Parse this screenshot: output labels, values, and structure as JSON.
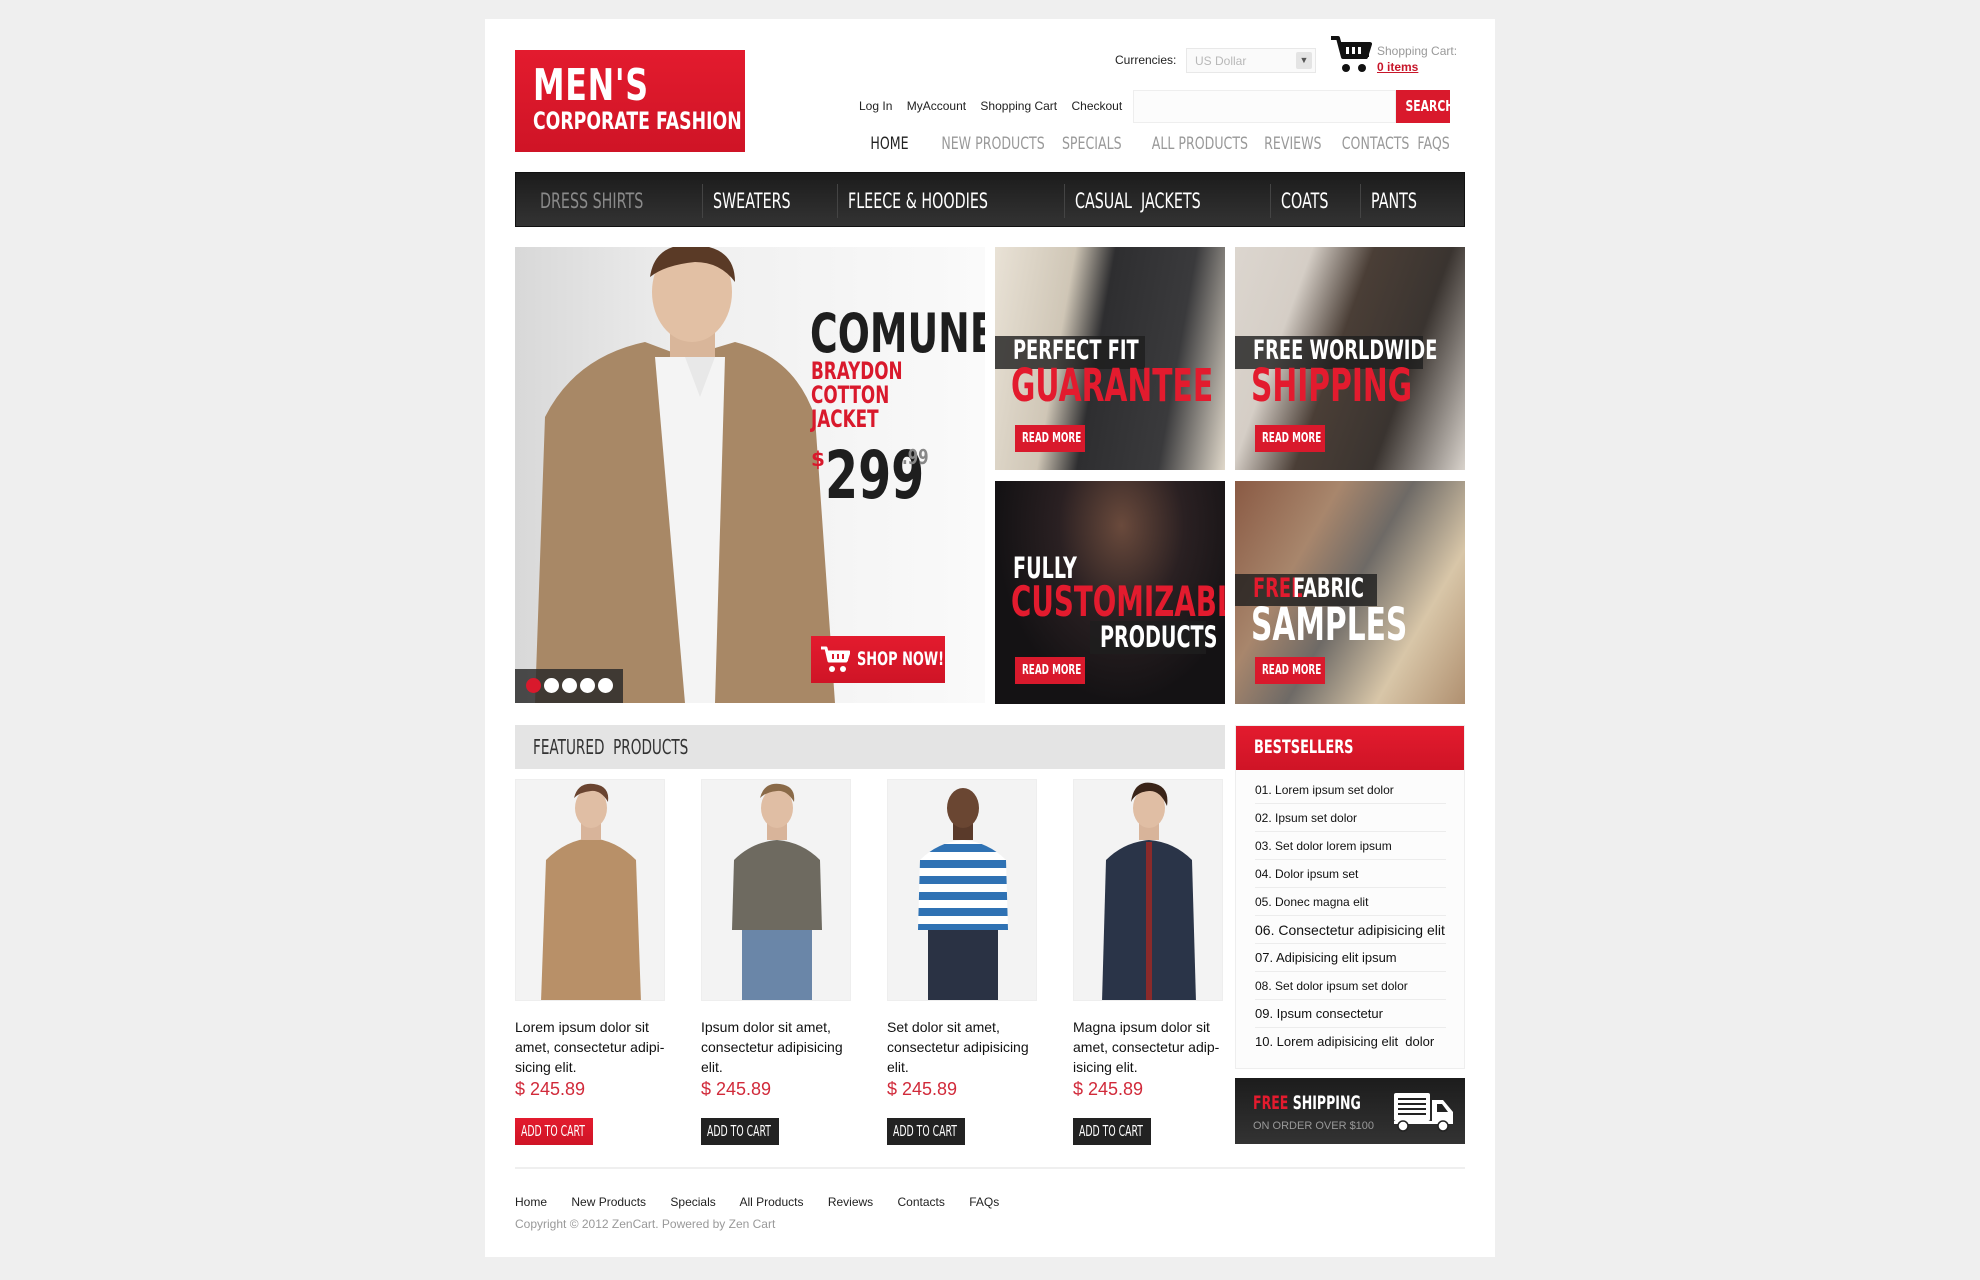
{
  "logo": {
    "line1": "MEN'S",
    "line2": "CORPORATE FASHION"
  },
  "header": {
    "currency_label": "Currencies:",
    "currency_value": "US Dollar",
    "cart_label": "Shopping Cart:",
    "cart_items": "0 items",
    "top_links": [
      "Log In",
      "MyAccount",
      "Shopping Cart",
      "Checkout"
    ],
    "search_placeholder": "",
    "search_button": "SEARCH",
    "main_nav": [
      {
        "label": "HOME",
        "active": true
      },
      {
        "label": "NEW PRODUCTS",
        "active": false
      },
      {
        "label": "SPECIALS",
        "active": false
      },
      {
        "label": "ALL PRODUCTS",
        "active": false
      },
      {
        "label": "REVIEWS",
        "active": false
      },
      {
        "label": "CONTACTS",
        "active": false
      },
      {
        "label": "FAQS",
        "active": false
      }
    ]
  },
  "categories": [
    "DRESS SHIRTS",
    "SWEATERS",
    "FLEECE & HOODIES",
    "CASUAL  JACKETS",
    "COATS",
    "PANTS"
  ],
  "slider": {
    "brand": "COMUNE",
    "subtitle": [
      "BRAYDON",
      "COTTON",
      "JACKET"
    ],
    "currency": "$",
    "price": "299",
    "cents": ".99",
    "button": "SHOP NOW!",
    "slide_count": 5,
    "active_slide": 1
  },
  "banners": [
    {
      "line1": "PERFECT FIT",
      "line2": "GUARANTEE",
      "button": "READ MORE"
    },
    {
      "line1": "FREE WORLDWIDE",
      "line2": "SHIPPING",
      "button": "READ MORE"
    },
    {
      "line1": "FULLY",
      "line2": "CUSTOMIZABLE",
      "line3": "PRODUCTS",
      "button": "READ MORE"
    },
    {
      "line1_red": "FREE",
      "line1_white": "FABRIC",
      "line2": "SAMPLES",
      "button": "READ MORE"
    }
  ],
  "featured": {
    "title": "FEATURED  PRODUCTS",
    "products": [
      {
        "name": "Lorem ipsum dolor sit amet, consectetur adipi-sicing elit.",
        "price": "$ 245.89",
        "button": "ADD TO CART"
      },
      {
        "name": "Ipsum dolor sit amet, consectetur adipisicing elit.",
        "price": "$ 245.89",
        "button": "ADD TO CART"
      },
      {
        "name": "Set dolor sit amet, consectetur adipisicing elit.",
        "price": "$ 245.89",
        "button": "ADD TO CART"
      },
      {
        "name": "Magna ipsum dolor sit amet, consectetur adip-isicing elit.",
        "price": "$ 245.89",
        "button": "ADD TO CART"
      }
    ]
  },
  "bestsellers": {
    "title": "BESTSELLERS",
    "items": [
      "01. Lorem ipsum set dolor",
      "02. Ipsum set dolor",
      "03. Set dolor lorem ipsum",
      "04. Dolor ipsum set",
      "05. Donec magna elit",
      "06. Consectetur adipisicing elit",
      "07. Adipisicing elit ipsum",
      "08. Set dolor ipsum set dolor",
      "09. Ipsum consectetur",
      "10. Lorem adipisicing elit  dolor"
    ]
  },
  "free_shipping": {
    "red": "FREE",
    "white": "SHIPPING",
    "sub": "ON ORDER OVER $100"
  },
  "footer": {
    "links": [
      "Home",
      "New Products",
      "Specials",
      "All Products",
      "Reviews",
      "Contacts",
      "FAQs"
    ],
    "copyright": "Copyright © 2012 ZenCart. Powered by Zen Cart"
  },
  "colors": {
    "accent": "#d9192c",
    "dark": "#222222",
    "price": "#d12a3a"
  }
}
